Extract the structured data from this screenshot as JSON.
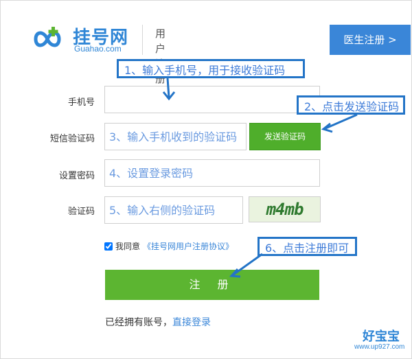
{
  "header": {
    "brand_name": "挂号网",
    "brand_domain": "Guahao.com",
    "page_title": "用 户 注 册",
    "doctor_register_label": "医生注册 >"
  },
  "form": {
    "phone_label": "手机号",
    "phone_value": "",
    "sms_label": "短信验证码",
    "sms_placeholder": "3、输入手机收到的验证码",
    "send_code_label": "发送验证码",
    "password_label": "设置密码",
    "password_placeholder": "4、设置登录密码",
    "captcha_label": "验证码",
    "captcha_placeholder": "5、输入右侧的验证码",
    "captcha_text": "m4mb",
    "agree_checked": true,
    "agree_text": "我同意",
    "agree_link": "《挂号网用户注册协议》",
    "register_label": "注 册",
    "have_account_text": "已经拥有账号，",
    "login_link": "直接登录"
  },
  "annotations": {
    "step1": "1、输入手机号，用于接收验证码",
    "step2": "2、点击发送验证码",
    "step6": "6、点击注册即可"
  },
  "watermark": {
    "name": "好宝宝",
    "url": "www.up927.com"
  },
  "colors": {
    "brand_blue": "#2f86d6",
    "green": "#5cb531",
    "annotation_border": "#2374c7"
  }
}
